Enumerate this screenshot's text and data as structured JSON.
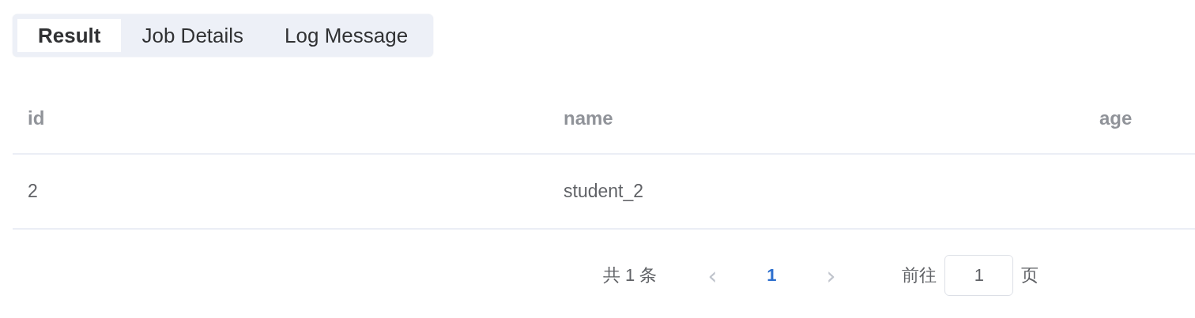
{
  "tabs": [
    {
      "label": "Result",
      "selected": true
    },
    {
      "label": "Job Details",
      "selected": false
    },
    {
      "label": "Log Message",
      "selected": false
    }
  ],
  "table": {
    "columns": [
      "id",
      "name",
      "age"
    ],
    "rows": [
      [
        "2",
        "student_2",
        ""
      ]
    ]
  },
  "pagination": {
    "total": "共 1 条",
    "prev": {
      "glyph": "‹",
      "disabled": true
    },
    "pages": [
      {
        "label": "1",
        "selected": true
      }
    ],
    "next": {
      "glyph": "›",
      "disabled": true
    },
    "jumper": {
      "before": "前往",
      "value": "1",
      "after": "页"
    }
  }
}
